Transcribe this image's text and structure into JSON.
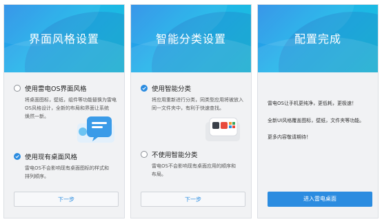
{
  "panel1": {
    "title": "界面风格设置",
    "option1": {
      "label": "使用雷电OS界面风格",
      "desc_lines": [
        "将桌面图标，壁纸，组件等功能替换为雷电",
        "OS风格设计，全新的布局和界面让系统",
        "焕然一新。"
      ],
      "checked": false
    },
    "option2": {
      "label": "使用现有桌面风格",
      "desc_lines": [
        "雷电OS不会影响现有桌面图标的样式和",
        "排列顺序。"
      ],
      "checked": true
    },
    "button": "下一步"
  },
  "panel2": {
    "title": "智能分类设置",
    "option1": {
      "label": "使用智能分类",
      "desc_lines": [
        "将应用重新进行分类，同类型应用将被放入",
        "同一文件夹中，有利于快速查找。"
      ],
      "checked": true
    },
    "option2": {
      "label": "不使用智能分类",
      "desc_lines": [
        "雷电OS不会影响现有桌面应用的顺序和",
        "布局。"
      ],
      "checked": false
    },
    "button": "下一步"
  },
  "panel3": {
    "title": "配置完成",
    "lines": [
      "雷电OS让手机更纯净，更低耗，更极速！",
      "全新UI风格覆盖图标，壁纸，文件夹等功能。",
      "更多内容敬请期待！"
    ],
    "button": "进入雷电桌面"
  },
  "colors": {
    "accent": "#2b8ce0",
    "hero_start": "#2a8fe8",
    "hero_end": "#17c4d8"
  }
}
